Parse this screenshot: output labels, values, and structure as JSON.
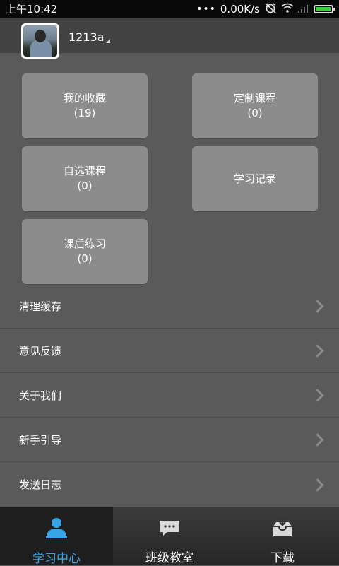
{
  "status_bar": {
    "time": "上午10:42",
    "dots": "•••",
    "network_speed": "0.00K/s",
    "battery_level": 0.95,
    "battery_color": "#38d43e",
    "icons": [
      "alarm-off-icon",
      "wifi-icon",
      "signal-icon",
      "battery-icon"
    ]
  },
  "profile": {
    "username": "1213a"
  },
  "tiles": [
    {
      "label": "我的收藏",
      "count": "(19)"
    },
    {
      "label": "定制课程",
      "count": "(0)"
    },
    {
      "label": "自选课程",
      "count": "(0)"
    },
    {
      "label": "学习记录",
      "count": ""
    },
    {
      "label": "课后练习",
      "count": "(0)"
    }
  ],
  "menu": [
    {
      "label": "清理缓存"
    },
    {
      "label": "意见反馈"
    },
    {
      "label": "关于我们"
    },
    {
      "label": "新手引导"
    },
    {
      "label": "发送日志"
    }
  ],
  "tabs": [
    {
      "label": "学习中心",
      "icon": "person-icon",
      "active": true
    },
    {
      "label": "班级教室",
      "icon": "chat-icon",
      "active": false
    },
    {
      "label": "下载",
      "icon": "download-tray-icon",
      "active": false
    }
  ],
  "colors": {
    "accent": "#3aa5e6",
    "tile": "#8c8c8c",
    "background": "#5a5a5a"
  }
}
